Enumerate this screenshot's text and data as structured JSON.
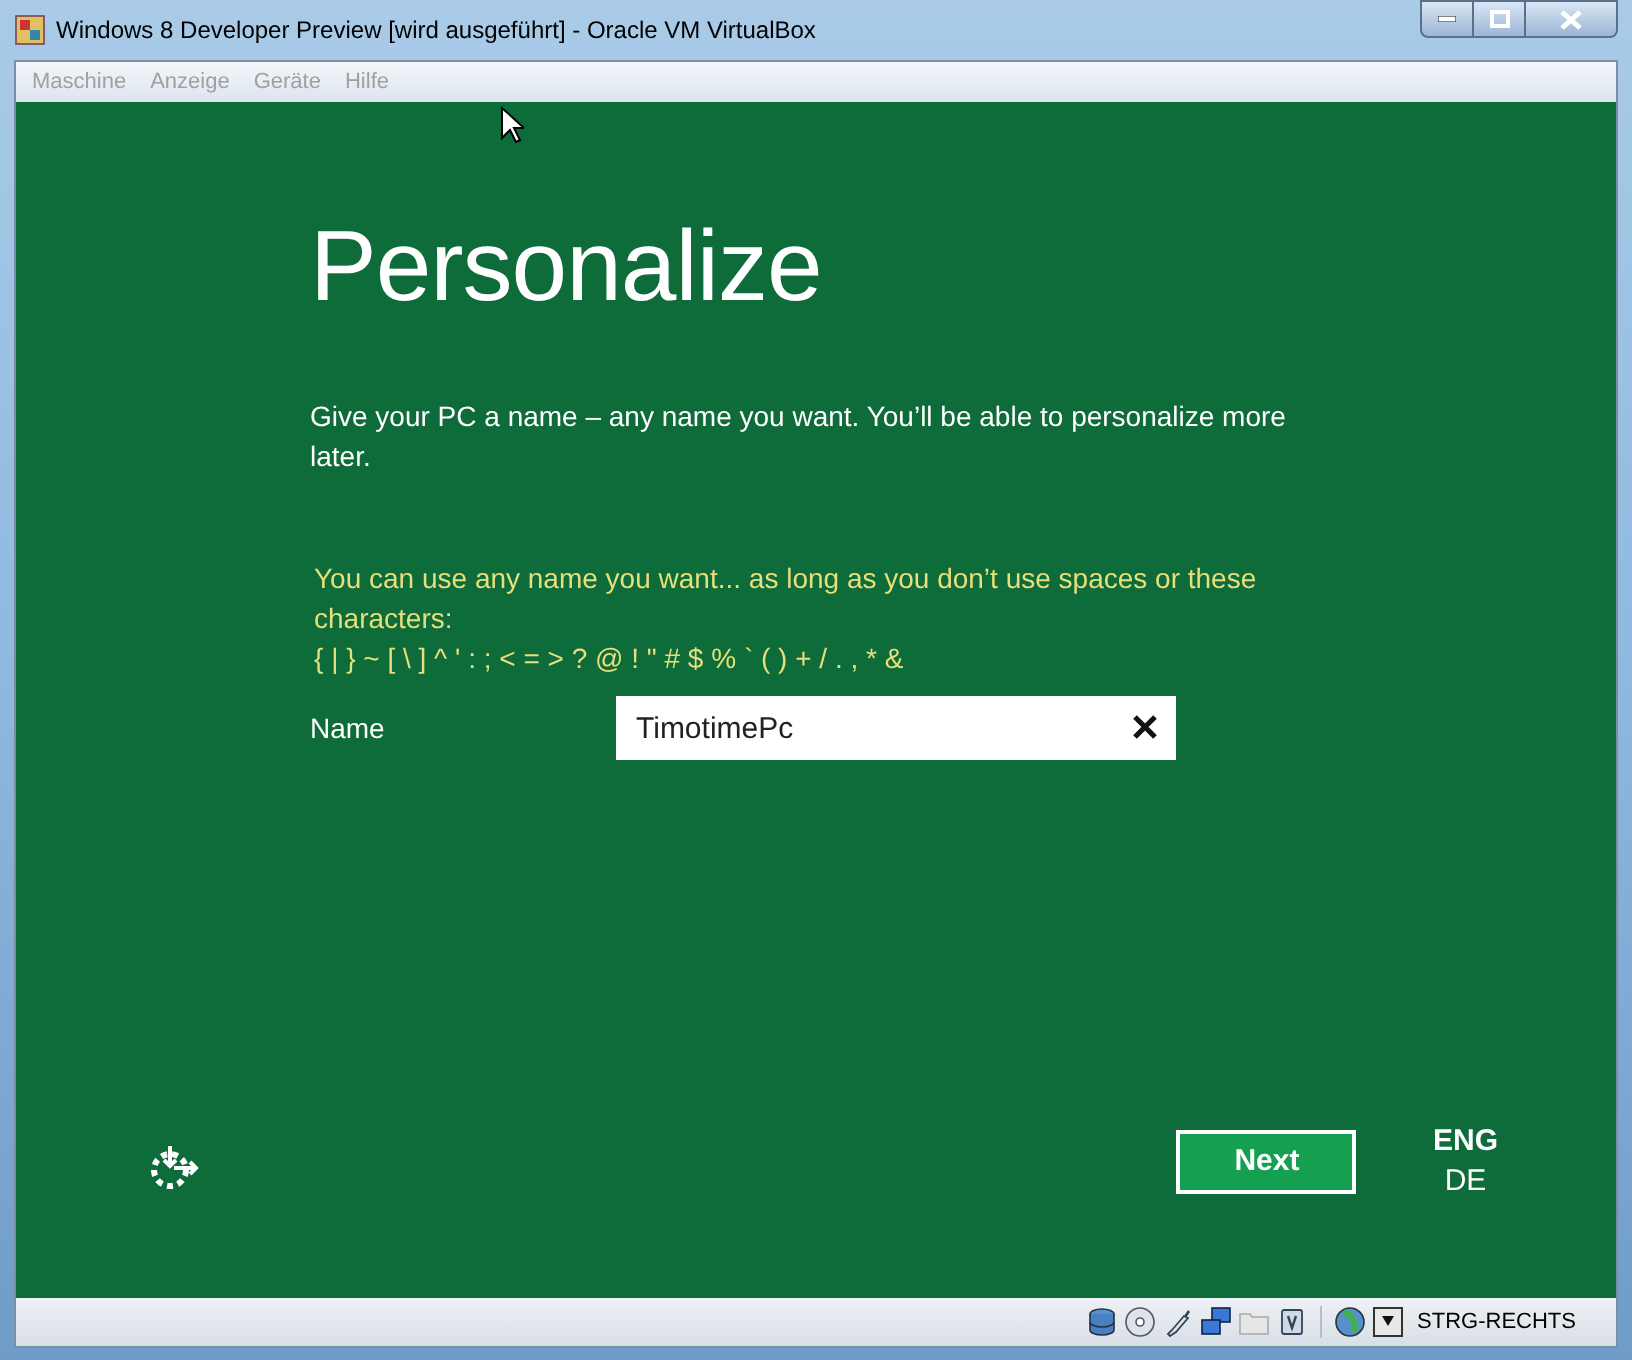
{
  "window": {
    "title": "Windows 8 Developer Preview [wird ausgeführt] - Oracle VM VirtualBox"
  },
  "menu": [
    {
      "label": "Maschine",
      "disabled": true
    },
    {
      "label": "Anzeige",
      "disabled": true
    },
    {
      "label": "Geräte",
      "disabled": true
    },
    {
      "label": "Hilfe",
      "disabled": true
    }
  ],
  "setup": {
    "heading": "Personalize",
    "intro": "Give your PC a name – any name you want. You’ll be able to personalize more later.",
    "warning": "You can use any name you want... as long as you don’t use spaces or these characters:",
    "forbidden": "{ | } ~ [ \\ ] ^ ' : ; < = > ? @ ! \" # $ % ` ( ) + / . , * &",
    "name_label": "Name",
    "name_value": "TimotimePc",
    "next_button": "Next",
    "languages": [
      {
        "label": "ENG",
        "selected": true
      },
      {
        "label": "DE",
        "selected": false
      }
    ]
  },
  "status_bar": {
    "host_key": "STRG-RECHTS"
  }
}
